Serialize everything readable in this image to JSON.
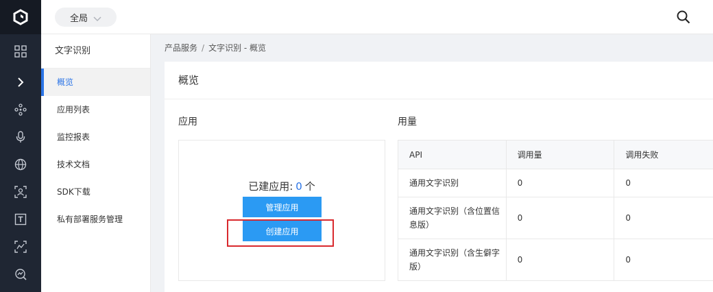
{
  "topbar": {
    "scope_label": "全局"
  },
  "subnav": {
    "title": "文字识别",
    "items": [
      {
        "label": "概览",
        "active": true
      },
      {
        "label": "应用列表"
      },
      {
        "label": "监控报表"
      },
      {
        "label": "技术文档"
      },
      {
        "label": "SDK下载"
      },
      {
        "label": "私有部署服务管理"
      }
    ]
  },
  "breadcrumb": {
    "root": "产品服务",
    "separator": "/",
    "current": "文字识别 - 概览"
  },
  "overview": {
    "title": "概览",
    "apps": {
      "section_title": "应用",
      "count_prefix": "已建应用:",
      "count_value": "0",
      "count_unit": "个",
      "manage_button": "管理应用",
      "create_button": "创建应用"
    },
    "usage": {
      "section_title": "用量",
      "columns": [
        "API",
        "调用量",
        "调用失败"
      ],
      "rows": [
        {
          "api": "通用文字识别",
          "calls": "0",
          "failures": "0"
        },
        {
          "api": "通用文字识别（含位置信息版）",
          "calls": "0",
          "failures": "0"
        },
        {
          "api": "通用文字识别（含生僻字版）",
          "calls": "0",
          "failures": "0"
        }
      ]
    }
  },
  "colors": {
    "accent": "#2b74e6",
    "button": "#2b9af3",
    "highlight": "#d9282d",
    "sidebar": "#1f2633"
  },
  "icons": [
    "logo-icon",
    "grid-icon",
    "chevron-right-icon",
    "nodes-icon",
    "microphone-icon",
    "globe-icon",
    "face-scan-icon",
    "text-box-icon",
    "scan-icon",
    "analytics-icon",
    "search-icon"
  ]
}
